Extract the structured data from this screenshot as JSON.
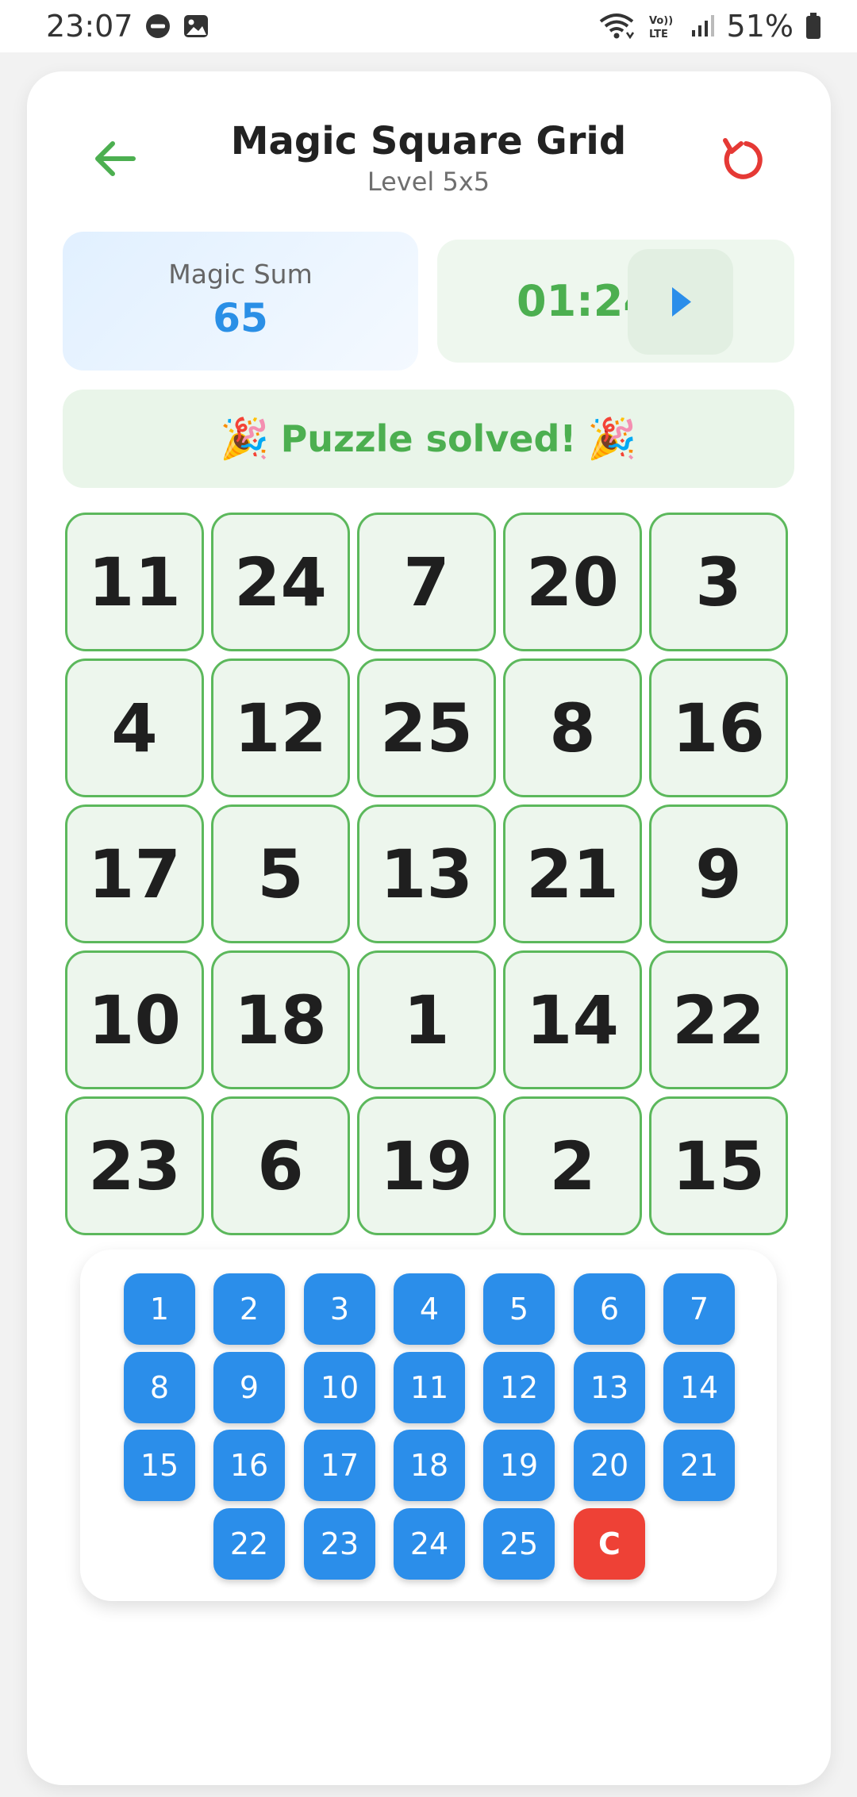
{
  "status": {
    "time": "23:07",
    "battery": "51%"
  },
  "header": {
    "title": "Magic Square Grid",
    "subtitle": "Level 5x5"
  },
  "stats": {
    "magic_sum_label": "Magic Sum",
    "magic_sum_value": "65",
    "timer": "01:24"
  },
  "banner": {
    "emoji": "🎉",
    "text": "Puzzle solved!"
  },
  "grid": {
    "rows": [
      [
        "11",
        "24",
        "7",
        "20",
        "3"
      ],
      [
        "4",
        "12",
        "25",
        "8",
        "16"
      ],
      [
        "17",
        "5",
        "13",
        "21",
        "9"
      ],
      [
        "10",
        "18",
        "1",
        "14",
        "22"
      ],
      [
        "23",
        "6",
        "19",
        "2",
        "15"
      ]
    ]
  },
  "keypad": {
    "keys": [
      "1",
      "2",
      "3",
      "4",
      "5",
      "6",
      "7",
      "8",
      "9",
      "10",
      "11",
      "12",
      "13",
      "14",
      "15",
      "16",
      "17",
      "18",
      "19",
      "20",
      "21",
      "22",
      "23",
      "24",
      "25"
    ],
    "clear_label": "C"
  },
  "colors": {
    "accent_green": "#4caf50",
    "accent_blue": "#2b8eea",
    "accent_red": "#ee4136"
  },
  "icons": {
    "back": "arrow-left-icon",
    "reset": "refresh-icon",
    "play": "play-icon"
  }
}
